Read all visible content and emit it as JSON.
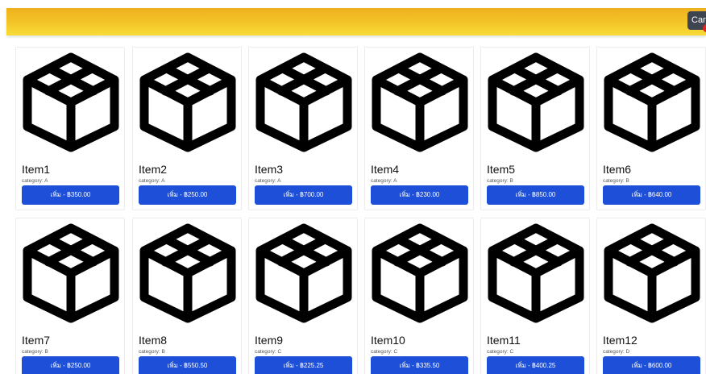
{
  "header": {
    "cart_label": "Cart"
  },
  "products": [
    {
      "name": "Item1",
      "category": "category: A",
      "button": "เพิ่ม - ฿350.00"
    },
    {
      "name": "Item2",
      "category": "category: A",
      "button": "เพิ่ม - ฿250.00"
    },
    {
      "name": "Item3",
      "category": "category: A",
      "button": "เพิ่ม - ฿700.00"
    },
    {
      "name": "Item4",
      "category": "category: A",
      "button": "เพิ่ม - ฿230.00"
    },
    {
      "name": "Item5",
      "category": "category: B",
      "button": "เพิ่ม - ฿850.00"
    },
    {
      "name": "Item6",
      "category": "category: B",
      "button": "เพิ่ม - ฿640.00"
    },
    {
      "name": "Item7",
      "category": "category: B",
      "button": "เพิ่ม - ฿250.00"
    },
    {
      "name": "Item8",
      "category": "category: B",
      "button": "เพิ่ม - ฿550.50"
    },
    {
      "name": "Item9",
      "category": "category: C",
      "button": "เพิ่ม - ฿225.25"
    },
    {
      "name": "Item10",
      "category": "category: C",
      "button": "เพิ่ม - ฿335.50"
    },
    {
      "name": "Item11",
      "category": "category: C",
      "button": "เพิ่ม - ฿400.25"
    },
    {
      "name": "Item12",
      "category": "category: D",
      "button": "เพิ่ม - ฿600.00"
    }
  ],
  "icons": {
    "product_image": "box-icon",
    "cart_badge": "notification-dot"
  },
  "colors": {
    "header_top": "#eeb01e",
    "header_bottom": "#f8dc37",
    "button": "#1d4fd8",
    "cart_button": "#3e4550",
    "badge": "#e02424"
  }
}
